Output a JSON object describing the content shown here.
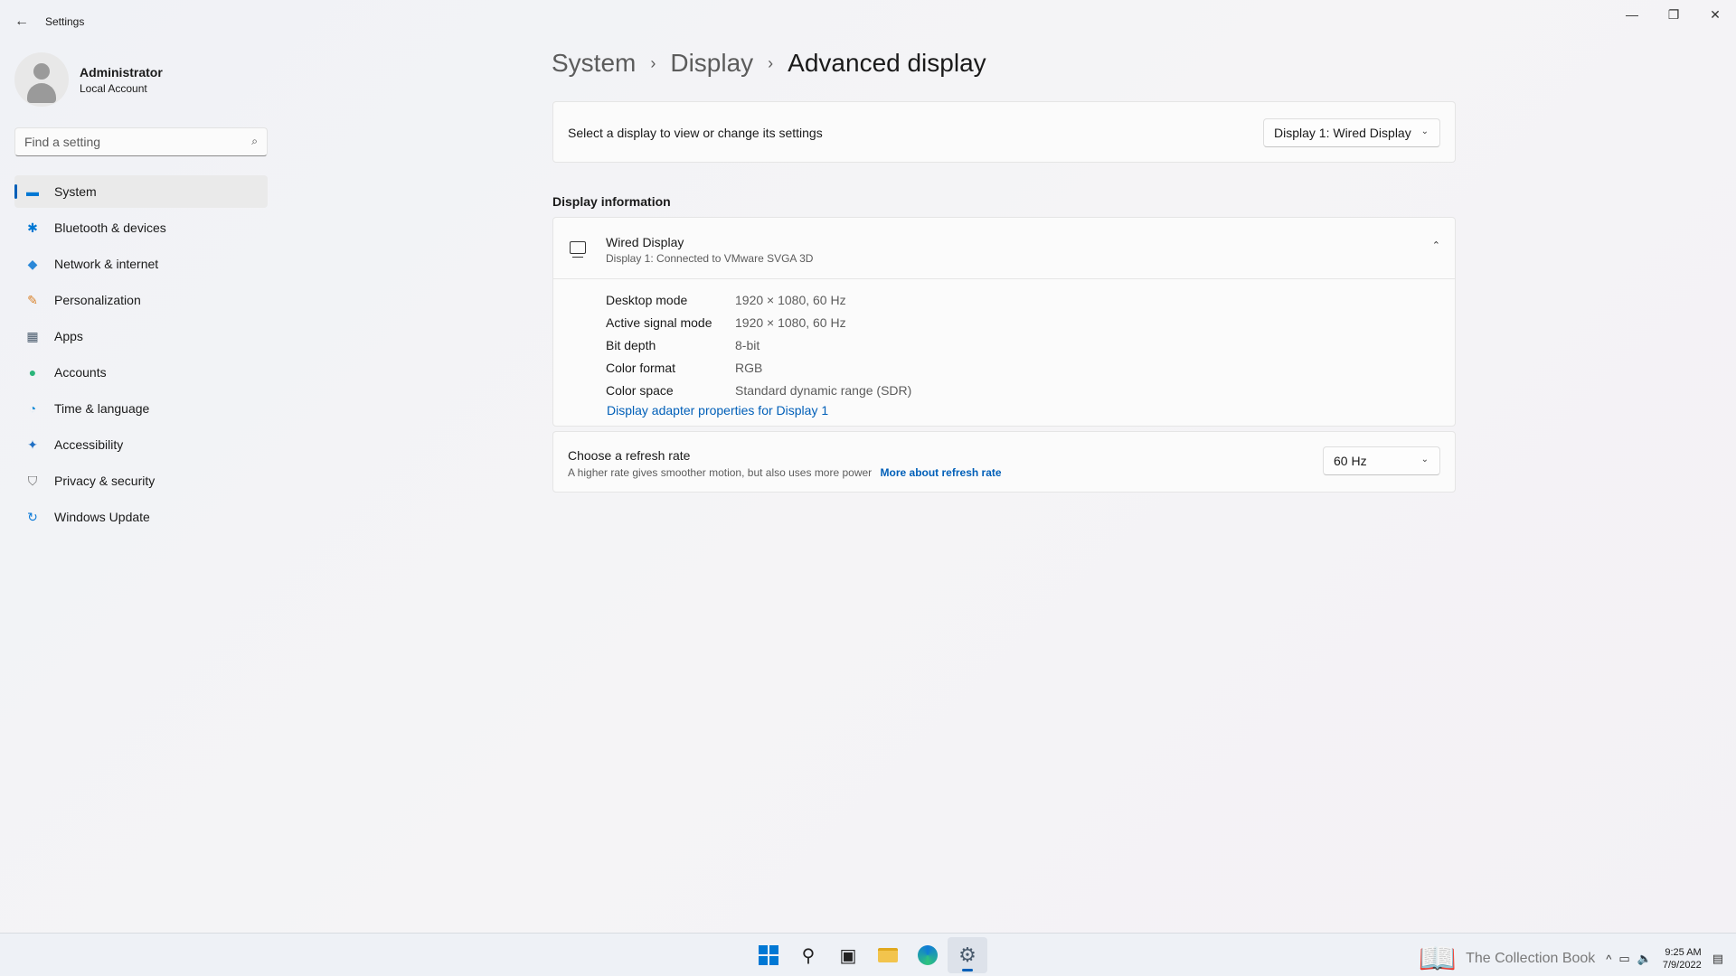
{
  "window": {
    "title": "Settings",
    "back_icon": "←",
    "minimize_icon": "—",
    "maximize_icon": "❐",
    "close_icon": "✕"
  },
  "profile": {
    "name": "Administrator",
    "account_type": "Local Account"
  },
  "search": {
    "placeholder": "Find a setting",
    "icon": "⌕"
  },
  "sidebar": {
    "items": [
      {
        "label": "System",
        "icon": "▬",
        "color": "#0078d4",
        "active": true
      },
      {
        "label": "Bluetooth & devices",
        "icon": "✱",
        "color": "#0078d4"
      },
      {
        "label": "Network & internet",
        "icon": "◆",
        "color": "#2b88d8"
      },
      {
        "label": "Personalization",
        "icon": "✎",
        "color": "#d9822b"
      },
      {
        "label": "Apps",
        "icon": "▦",
        "color": "#4a5b6d"
      },
      {
        "label": "Accounts",
        "icon": "●",
        "color": "#2bb57a"
      },
      {
        "label": "Time & language",
        "icon": "◔",
        "color": "#1f8fd8"
      },
      {
        "label": "Accessibility",
        "icon": "✦",
        "color": "#1f6fc4"
      },
      {
        "label": "Privacy & security",
        "icon": "⛉",
        "color": "#6b6b6b"
      },
      {
        "label": "Windows Update",
        "icon": "↻",
        "color": "#0f7bd8"
      }
    ]
  },
  "breadcrumb": {
    "items": [
      "System",
      "Display",
      "Advanced display"
    ],
    "separator": "›"
  },
  "display_select": {
    "label": "Select a display to view or change its settings",
    "value": "Display 1: Wired Display",
    "chevron": "⌄"
  },
  "display_information": {
    "section_title": "Display information",
    "title": "Wired Display",
    "subtitle": "Display 1: Connected to VMware SVGA 3D",
    "collapse_icon": "⌃",
    "rows": [
      {
        "key": "Desktop mode",
        "value": "1920 × 1080, 60 Hz"
      },
      {
        "key": "Active signal mode",
        "value": "1920 × 1080, 60 Hz"
      },
      {
        "key": "Bit depth",
        "value": "8-bit"
      },
      {
        "key": "Color format",
        "value": "RGB"
      },
      {
        "key": "Color space",
        "value": "Standard dynamic range (SDR)"
      }
    ],
    "adapter_link": "Display adapter properties for Display 1"
  },
  "refresh_rate": {
    "title": "Choose a refresh rate",
    "description": "A higher rate gives smoother motion, but also uses more power",
    "link": "More about refresh rate",
    "value": "60 Hz",
    "chevron": "⌄"
  },
  "taskbar": {
    "search_glyph": "⚲",
    "taskview_glyph": "▣",
    "settings_glyph": "⚙",
    "watermark": "The Collection Book",
    "book_glyph": "📖",
    "tray": {
      "chevron": "^",
      "network": "▭",
      "volume": "🔈",
      "time": "9:25 AM",
      "date": "7/9/2022",
      "notification": "▤"
    }
  },
  "colors": {
    "accent": "#005fb8",
    "link": "#005fb8"
  }
}
